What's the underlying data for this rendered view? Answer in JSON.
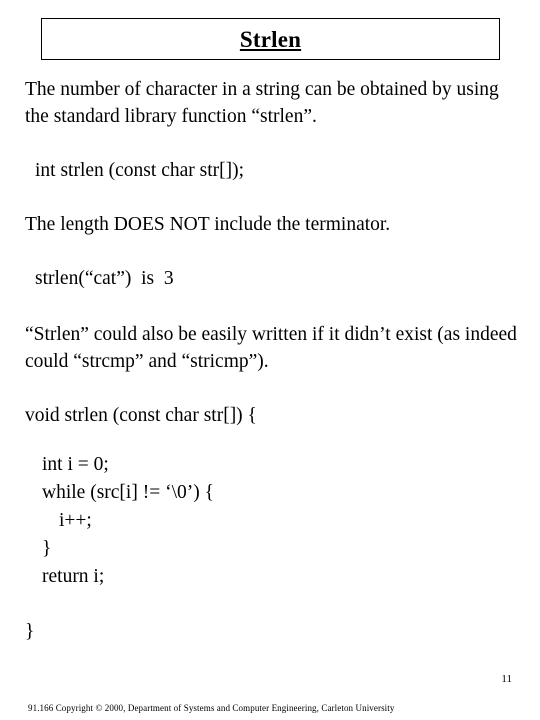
{
  "slide": {
    "title": "Strlen",
    "paragraphs": [
      {
        "id": "intro",
        "text": "The number of character in a string can be obtained by using the standard library function “strlen”."
      },
      {
        "id": "prototype",
        "text": "int strlen (const char str[]);"
      },
      {
        "id": "terminator-note",
        "text": "The length DOES NOT include the terminator."
      },
      {
        "id": "example",
        "text": "strlen(“cat”)  is  3"
      },
      {
        "id": "could-be-written",
        "text": "“Strlen” could also be easily written if it didn’t exist (as indeed could “strcmp” and “stricmp”)."
      }
    ],
    "code": {
      "signature": "void strlen (const char str[]) {",
      "lines": [
        {
          "text": "int i = 0;",
          "level": 1
        },
        {
          "text": "while (src[i] != ‘\\0’) {",
          "level": 1
        },
        {
          "text": "i++;",
          "level": 2
        },
        {
          "text": "}",
          "level": 1
        },
        {
          "text": "return i;",
          "level": 1
        }
      ],
      "closing_brace": "}"
    },
    "page_number": "11",
    "footer": "91.166 Copyright © 2000, Department of Systems and Computer Engineering, Carleton University"
  }
}
